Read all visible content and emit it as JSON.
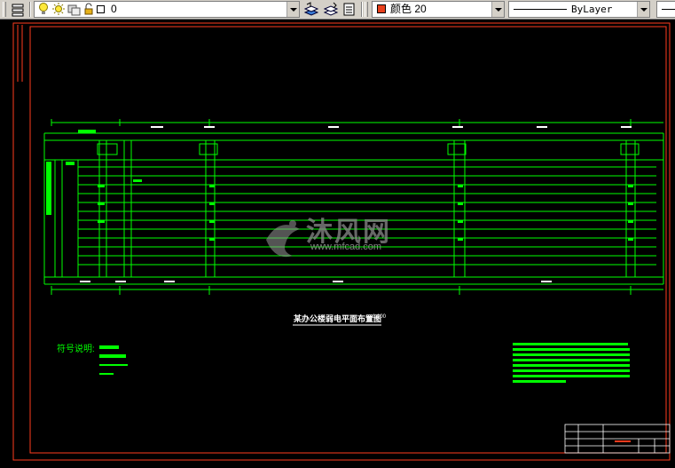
{
  "toolbar": {
    "layer_value": "0",
    "color_label": "颜色 20",
    "linetype_label": "ByLayer",
    "color_swatch": "#e8401c"
  },
  "drawing": {
    "title": "某办公楼弱电平面布置图",
    "title_suffix": "1:100",
    "legend_heading": "符号说明:",
    "watermark_brand": "沐风网",
    "watermark_url": "www.mfcad.com"
  },
  "colors": {
    "background": "#000000",
    "frame": "#ff3b1e",
    "lines": "#00ff00",
    "white": "#ffffff"
  }
}
